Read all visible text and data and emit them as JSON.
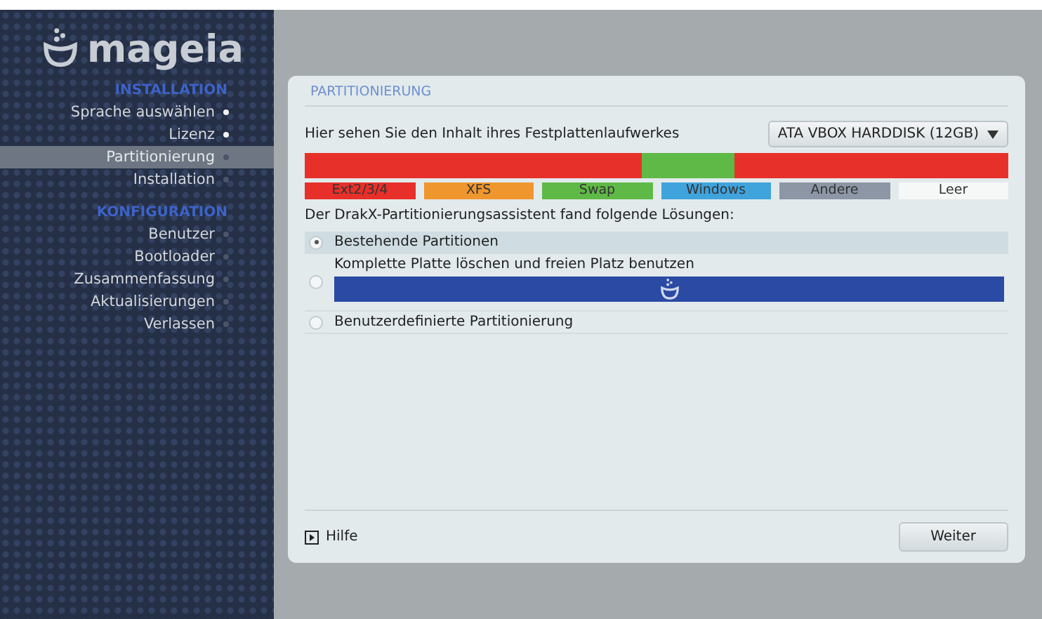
{
  "logo": {
    "text": "mageia"
  },
  "sidebar": {
    "sections": [
      {
        "title": "INSTALLATION",
        "items": [
          {
            "label": "Sprache auswählen",
            "done": true,
            "selected": false
          },
          {
            "label": "Lizenz",
            "done": true,
            "selected": false
          },
          {
            "label": "Partitionierung",
            "done": false,
            "selected": true
          },
          {
            "label": "Installation",
            "done": false,
            "selected": false
          }
        ]
      },
      {
        "title": "KONFIGURATION",
        "items": [
          {
            "label": "Benutzer",
            "done": false,
            "selected": false
          },
          {
            "label": "Bootloader",
            "done": false,
            "selected": false
          },
          {
            "label": "Zusammenfassung",
            "done": false,
            "selected": false
          },
          {
            "label": "Aktualisierungen",
            "done": false,
            "selected": false
          },
          {
            "label": "Verlassen",
            "done": false,
            "selected": false
          }
        ]
      }
    ]
  },
  "panel": {
    "title": "PARTITIONIERUNG",
    "disk_label": "Hier sehen Sie den Inhalt ihres Festplattenlaufwerkes",
    "disk_select": {
      "value": "ATA VBOX HARDDISK (12GB)"
    },
    "partitions": [
      {
        "color": "#e8302a"
      },
      {
        "color": "#5fb946"
      },
      {
        "color": "#e8302a"
      }
    ],
    "legend": [
      {
        "label": "Ext2/3/4",
        "color": "#e8302a"
      },
      {
        "label": "XFS",
        "color": "#f0962e"
      },
      {
        "label": "Swap",
        "color": "#5fb946"
      },
      {
        "label": "Windows",
        "color": "#3fa3dc"
      },
      {
        "label": "Andere",
        "color": "#8c96a5"
      },
      {
        "label": "Leer",
        "color": "#f6f8f8"
      }
    ],
    "intro": "Der DrakX-Partitionierungsassistent fand folgende Lösungen:",
    "options": [
      {
        "kind": "plain",
        "label": "Bestehende Partitionen",
        "selected": true,
        "highlighted": true
      },
      {
        "kind": "disk",
        "label": "Komplette Platte löschen und freien Platz benutzen",
        "selected": false,
        "highlighted": false
      },
      {
        "kind": "plain",
        "label": "Benutzerdefinierte Partitionierung",
        "selected": false,
        "highlighted": false
      }
    ],
    "help": "Hilfe",
    "next_button": "Weiter"
  }
}
